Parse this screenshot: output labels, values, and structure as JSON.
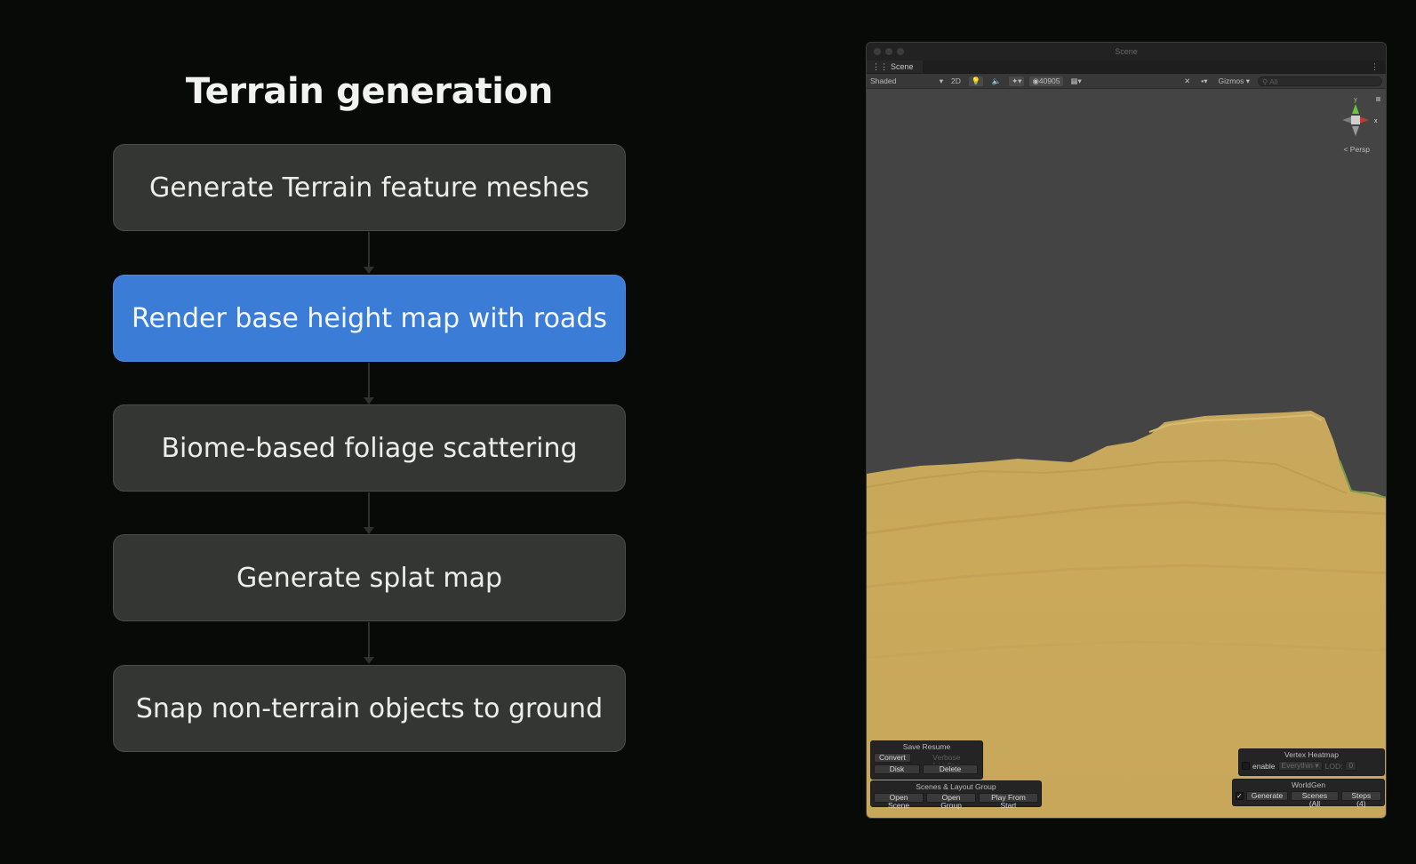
{
  "diagram": {
    "title": "Terrain generation",
    "steps": [
      {
        "label": "Generate Terrain feature meshes",
        "active": false
      },
      {
        "label": "Render base height map with roads",
        "active": true
      },
      {
        "label": "Biome-based foliage scattering",
        "active": false
      },
      {
        "label": "Generate splat map",
        "active": false
      },
      {
        "label": "Snap non-terrain objects to ground",
        "active": false
      }
    ]
  },
  "editor": {
    "window_title": "Scene",
    "tab_label": "Scene",
    "tab_icon": "grid-icon",
    "toolbar": {
      "shading_mode": "Shaded",
      "mode_2d": "2D",
      "visible_count": "40905",
      "gizmos_label": "Gizmos",
      "search_placeholder": "All"
    },
    "gizmo": {
      "y": "y",
      "x": "x",
      "projection": "< Persp"
    },
    "panels": {
      "save_resume": {
        "title": "Save Resume",
        "convert": "Convert",
        "verbose": "Verbose Loading",
        "disk": "Disk",
        "delete": "Delete"
      },
      "scenes_layout": {
        "title": "Scenes & Layout Group",
        "open_scene": "Open Scene",
        "open_group": "Open Group",
        "play_from_start": "Play From Start"
      },
      "vertex_heatmap": {
        "title": "Vertex Heatmap",
        "enable": "enable",
        "everything": "Everythin",
        "lod_label": "LOD:",
        "lod_value": "0"
      },
      "worldgen": {
        "title": "WorldGen",
        "generate": "Generate",
        "scenes": "Scenes (All",
        "steps": "Steps (4)"
      }
    },
    "colors": {
      "terrain": "#c9a95a",
      "sky": "#444444",
      "active_step": "#3b7cd6"
    }
  }
}
